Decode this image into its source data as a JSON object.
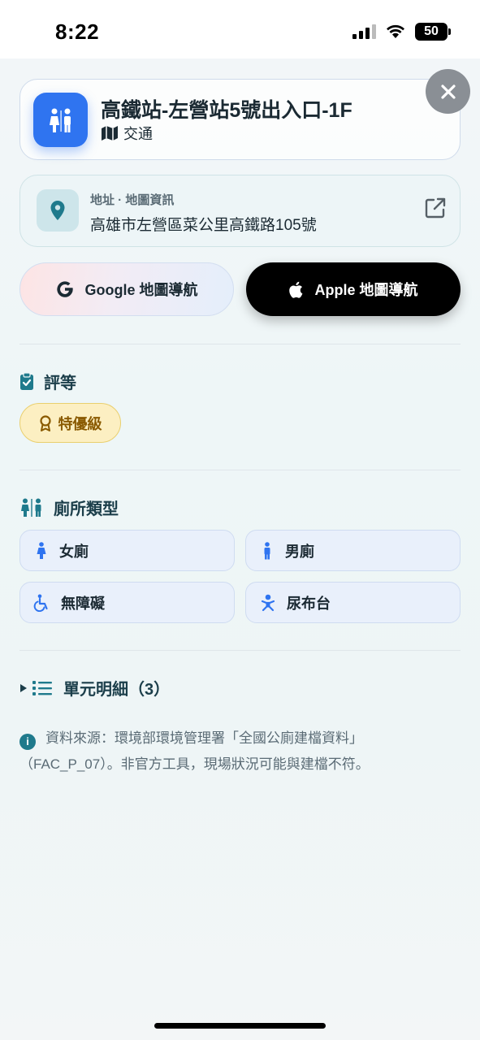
{
  "status_bar": {
    "time": "8:22",
    "battery": "50"
  },
  "header": {
    "title": "高鐵站-左營站5號出入口-1F",
    "category": "交通"
  },
  "address": {
    "label": "地址 · 地圖資訊",
    "text": "高雄市左營區菜公里高鐵路105號"
  },
  "navigation": {
    "google_label": "Google 地圖導航",
    "apple_label": "Apple 地圖導航"
  },
  "rating": {
    "heading": "評等",
    "badge": "特優級"
  },
  "toilet_types": {
    "heading": "廁所類型",
    "items": [
      {
        "label": "女廁",
        "icon": "woman-icon"
      },
      {
        "label": "男廁",
        "icon": "man-icon"
      },
      {
        "label": "無障礙",
        "icon": "wheelchair-icon"
      },
      {
        "label": "尿布台",
        "icon": "baby-icon"
      }
    ]
  },
  "units": {
    "heading": "單元明細（3）"
  },
  "note": {
    "text": "資料來源：環境部環境管理署「全國公廁建檔資料」（FAC_P_07）。非官方工具，現場狀況可能與建檔不符。"
  },
  "colors": {
    "accent": "#2f74f0",
    "teal": "#1f7a8c",
    "badge_bg": "#fcefc2",
    "badge_text": "#8a5a00"
  }
}
